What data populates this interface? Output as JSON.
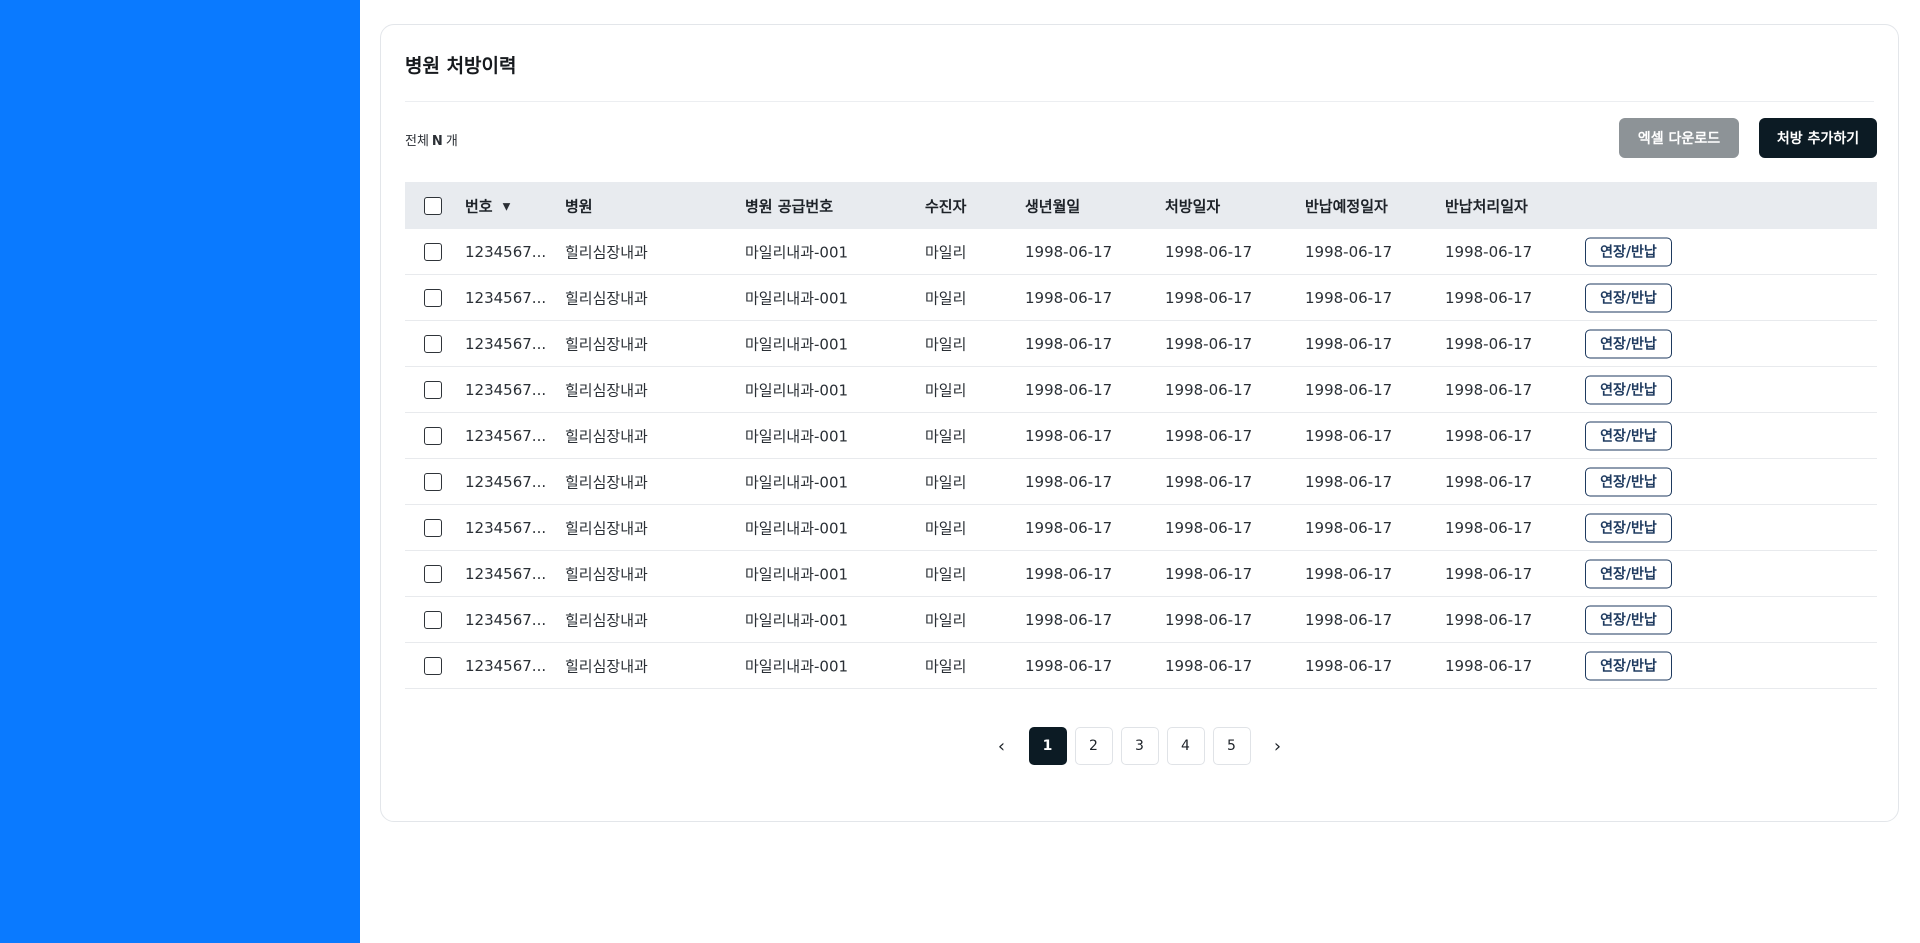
{
  "colors": {
    "sidebar": "#0a7aff",
    "primary_dark": "#0c1b24",
    "excel_button": "#8d9397",
    "header_bg": "#e8ebef",
    "action_border": "#1e3a5f"
  },
  "card": {
    "title": "병원 처방이력",
    "total_prefix": "전체",
    "total_count": "N",
    "total_suffix": "개",
    "excel_button": "엑셀 다운로드",
    "add_button": "처방 추가하기"
  },
  "table": {
    "columns": [
      "번호",
      "병원",
      "병원 공급번호",
      "수진자",
      "생년월일",
      "처방일자",
      "반납예정일자",
      "반납처리일자"
    ],
    "sort_icon": "chevron-down-icon",
    "rows": [
      {
        "num": "1234567...",
        "hospital": "힐리심장내과",
        "supply_no": "마일리내과-001",
        "recipient": "마일리",
        "birth": "1998-06-17",
        "prescribed": "1998-06-17",
        "return_due": "1998-06-17",
        "return_done": "1998-06-17",
        "action": "연장/반납"
      },
      {
        "num": "1234567...",
        "hospital": "힐리심장내과",
        "supply_no": "마일리내과-001",
        "recipient": "마일리",
        "birth": "1998-06-17",
        "prescribed": "1998-06-17",
        "return_due": "1998-06-17",
        "return_done": "1998-06-17",
        "action": "연장/반납"
      },
      {
        "num": "1234567...",
        "hospital": "힐리심장내과",
        "supply_no": "마일리내과-001",
        "recipient": "마일리",
        "birth": "1998-06-17",
        "prescribed": "1998-06-17",
        "return_due": "1998-06-17",
        "return_done": "1998-06-17",
        "action": "연장/반납"
      },
      {
        "num": "1234567...",
        "hospital": "힐리심장내과",
        "supply_no": "마일리내과-001",
        "recipient": "마일리",
        "birth": "1998-06-17",
        "prescribed": "1998-06-17",
        "return_due": "1998-06-17",
        "return_done": "1998-06-17",
        "action": "연장/반납"
      },
      {
        "num": "1234567...",
        "hospital": "힐리심장내과",
        "supply_no": "마일리내과-001",
        "recipient": "마일리",
        "birth": "1998-06-17",
        "prescribed": "1998-06-17",
        "return_due": "1998-06-17",
        "return_done": "1998-06-17",
        "action": "연장/반납"
      },
      {
        "num": "1234567...",
        "hospital": "힐리심장내과",
        "supply_no": "마일리내과-001",
        "recipient": "마일리",
        "birth": "1998-06-17",
        "prescribed": "1998-06-17",
        "return_due": "1998-06-17",
        "return_done": "1998-06-17",
        "action": "연장/반납"
      },
      {
        "num": "1234567...",
        "hospital": "힐리심장내과",
        "supply_no": "마일리내과-001",
        "recipient": "마일리",
        "birth": "1998-06-17",
        "prescribed": "1998-06-17",
        "return_due": "1998-06-17",
        "return_done": "1998-06-17",
        "action": "연장/반납"
      },
      {
        "num": "1234567...",
        "hospital": "힐리심장내과",
        "supply_no": "마일리내과-001",
        "recipient": "마일리",
        "birth": "1998-06-17",
        "prescribed": "1998-06-17",
        "return_due": "1998-06-17",
        "return_done": "1998-06-17",
        "action": "연장/반납"
      },
      {
        "num": "1234567...",
        "hospital": "힐리심장내과",
        "supply_no": "마일리내과-001",
        "recipient": "마일리",
        "birth": "1998-06-17",
        "prescribed": "1998-06-17",
        "return_due": "1998-06-17",
        "return_done": "1998-06-17",
        "action": "연장/반납"
      },
      {
        "num": "1234567...",
        "hospital": "힐리심장내과",
        "supply_no": "마일리내과-001",
        "recipient": "마일리",
        "birth": "1998-06-17",
        "prescribed": "1998-06-17",
        "return_due": "1998-06-17",
        "return_done": "1998-06-17",
        "action": "연장/반납"
      }
    ]
  },
  "pagination": {
    "prev_icon": "chevron-left-icon",
    "next_icon": "chevron-right-icon",
    "pages": [
      "1",
      "2",
      "3",
      "4",
      "5"
    ],
    "current": "1"
  }
}
